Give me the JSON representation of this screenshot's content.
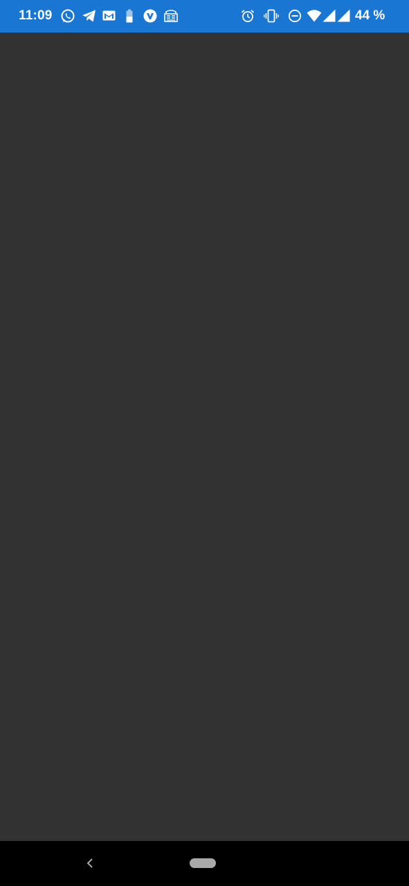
{
  "status_bar": {
    "time": "11:09",
    "background": "#1976d2",
    "left_icons": [
      "whatsapp-icon",
      "telegram-icon",
      "gmail-icon",
      "battery-saver-icon",
      "vivaldi-icon",
      "news-icon"
    ],
    "right_icons": [
      "alarm-icon",
      "vibrate-icon",
      "do-not-disturb-icon",
      "wifi-icon",
      "signal-icon",
      "signal-icon"
    ],
    "battery_text": "44 %"
  },
  "content": {
    "background": "#323232"
  },
  "nav_bar": {
    "buttons": [
      "back",
      "home"
    ],
    "background": "#000000"
  }
}
